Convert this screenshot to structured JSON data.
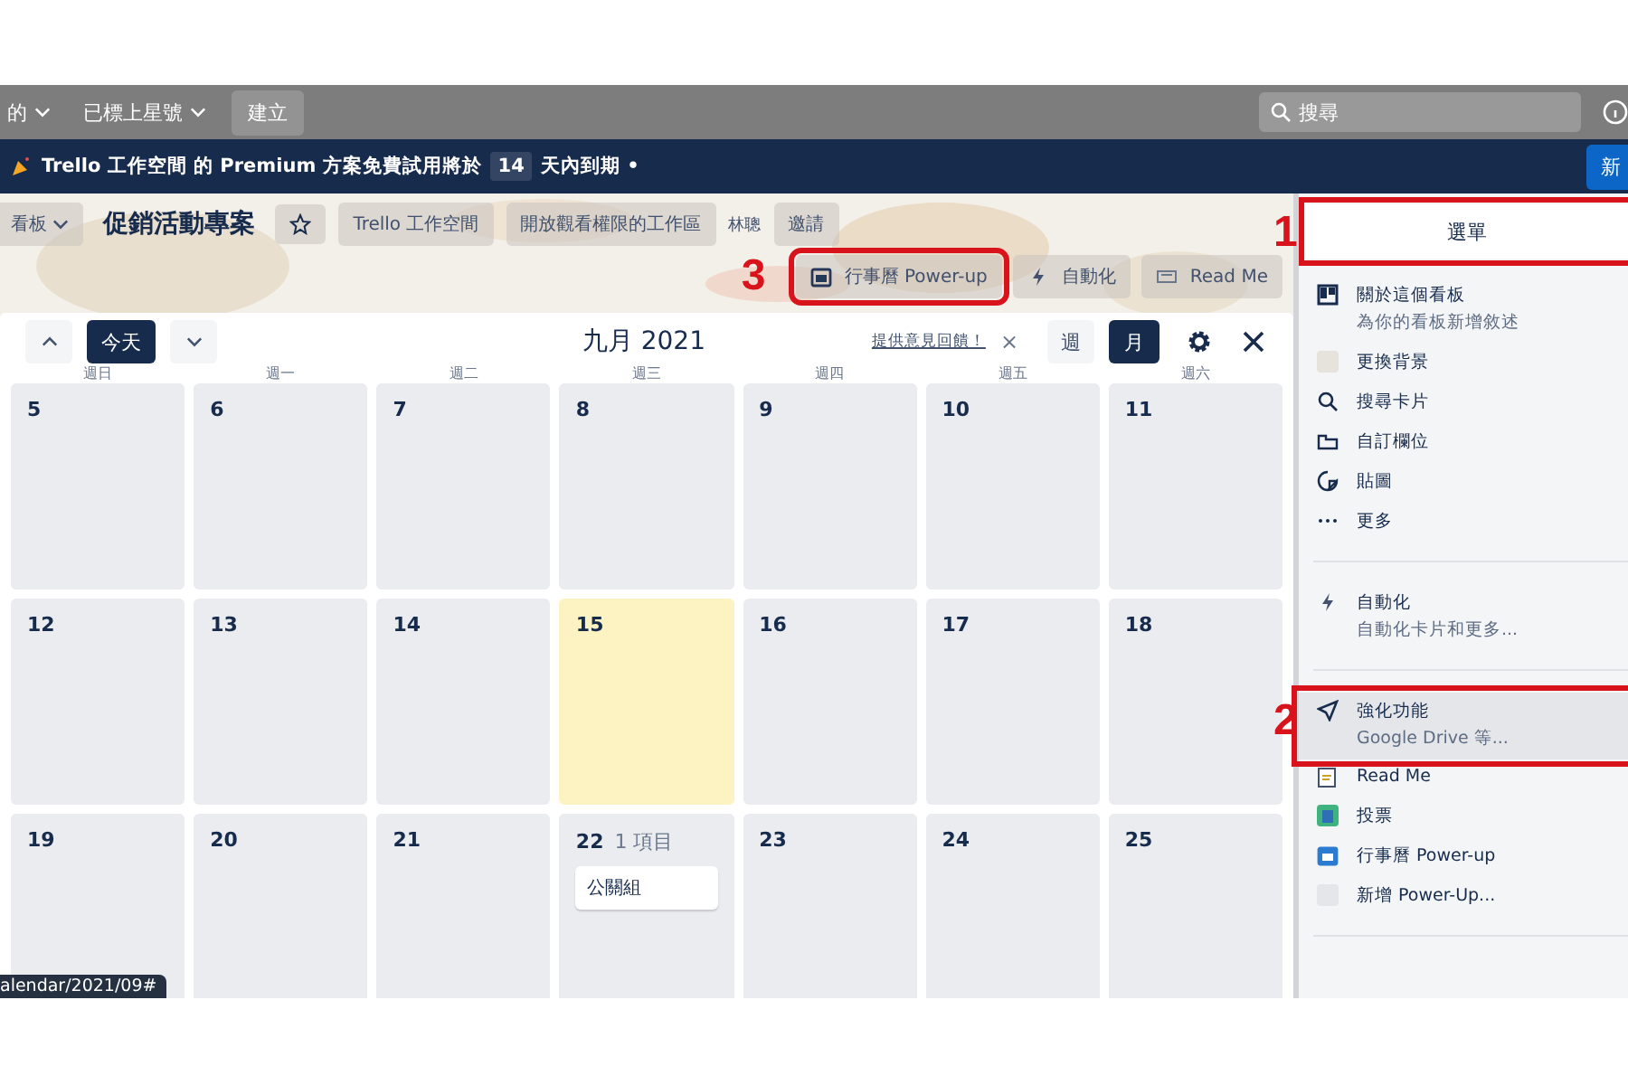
{
  "top_nav": {
    "items": [
      {
        "label": "的",
        "kind": "dropdown"
      },
      {
        "label": "已標上星號",
        "kind": "dropdown"
      },
      {
        "label": "建立",
        "kind": "button"
      }
    ],
    "search": {
      "placeholder": "搜尋"
    }
  },
  "banner": {
    "text": "Trello 工作空間 的 Premium 方案免費試用將於",
    "days": "14",
    "suffix": "天內到期 •",
    "button": "新"
  },
  "board_header": {
    "view": "看板",
    "title": "促銷活動專案",
    "workspace": "Trello 工作空間",
    "visibility": "開放觀看權限的工作區",
    "member": "林聰",
    "invite": "邀請"
  },
  "powerups": [
    {
      "label": "行事曆 Power-up",
      "kind": "calendar",
      "callout": "3"
    },
    {
      "label": "自動化",
      "kind": "bolt"
    },
    {
      "label": "Read Me",
      "kind": "card"
    }
  ],
  "calendar": {
    "today": "今天",
    "title": "九月 2021",
    "feedback": "提供意見回饋！",
    "close_feedback": "×",
    "views": [
      {
        "label": "週",
        "selected": false
      },
      {
        "label": "月",
        "selected": true
      }
    ],
    "weekdays": [
      "週日",
      "週一",
      "週二",
      "週三",
      "週四",
      "週五",
      "週六"
    ],
    "weeks": [
      [
        {
          "day": "5",
          "today": false
        },
        {
          "day": "6",
          "today": false
        },
        {
          "day": "7",
          "today": false
        },
        {
          "day": "8",
          "today": false
        },
        {
          "day": "9",
          "today": false
        },
        {
          "day": "10",
          "today": false
        },
        {
          "day": "11",
          "today": false
        }
      ],
      [
        {
          "day": "12",
          "today": false
        },
        {
          "day": "13",
          "today": false
        },
        {
          "day": "14",
          "today": false
        },
        {
          "day": "15",
          "today": true
        },
        {
          "day": "16",
          "today": false
        },
        {
          "day": "17",
          "today": false
        },
        {
          "day": "18",
          "today": false
        }
      ],
      [
        {
          "day": "19",
          "today": false
        },
        {
          "day": "20",
          "today": false
        },
        {
          "day": "21",
          "today": false
        },
        {
          "day": "22",
          "today": false,
          "count": "1 項目",
          "cards": [
            "公關組"
          ]
        },
        {
          "day": "23",
          "today": false
        },
        {
          "day": "24",
          "today": false
        },
        {
          "day": "25",
          "today": false
        }
      ]
    ]
  },
  "sidebar": {
    "title": "選單",
    "callout": "1",
    "sections": [
      [
        {
          "label": "關於這個看板",
          "sub": "為你的看板新增敘述",
          "kind": "board",
          "selected": false
        },
        {
          "label": "更換背景",
          "kind": "swatch",
          "selected": false
        },
        {
          "label": "搜尋卡片",
          "kind": "search",
          "selected": false
        },
        {
          "label": "自訂欄位",
          "kind": "field",
          "selected": false
        },
        {
          "label": "貼圖",
          "kind": "sticker",
          "selected": false
        },
        {
          "label": "更多",
          "kind": "more",
          "selected": false
        }
      ],
      [
        {
          "label": "自動化",
          "sub": "自動化卡片和更多...",
          "kind": "bolt",
          "selected": false
        }
      ],
      [
        {
          "label": "強化功能",
          "sub": "Google Drive 等...",
          "kind": "rocket",
          "callout": "2",
          "selected": true
        },
        {
          "label": "Read Me",
          "kind": "note",
          "selected": false
        },
        {
          "label": "投票",
          "kind": "vote",
          "selected": false
        },
        {
          "label": "行事曆 Power-up",
          "kind": "cal",
          "selected": false
        },
        {
          "label": "新增 Power-Up...",
          "kind": "blank",
          "selected": false
        }
      ]
    ]
  },
  "status_url": "alendar/2021/09#"
}
